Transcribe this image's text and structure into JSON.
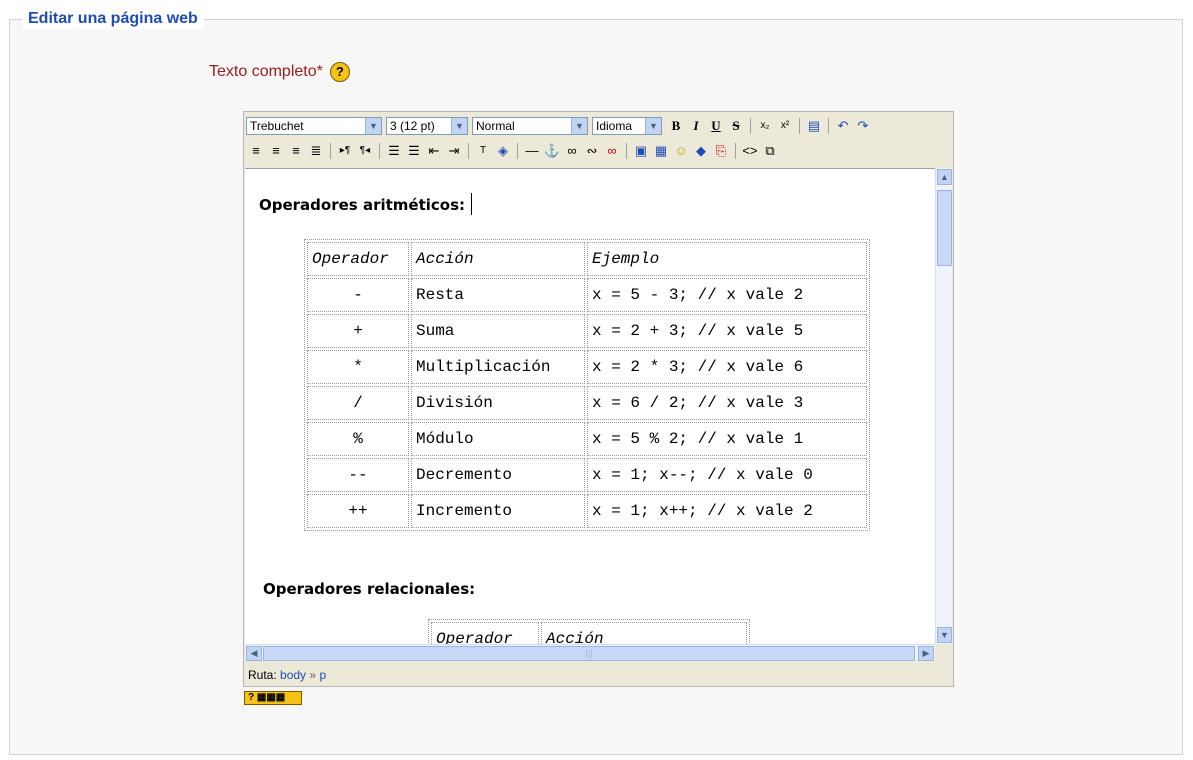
{
  "legend": "Editar una página web",
  "field": {
    "label": "Texto completo",
    "required_mark": "*",
    "help": "?"
  },
  "toolbar": {
    "font": "Trebuchet",
    "size": "3 (12 pt)",
    "format": "Normal",
    "language": "Idioma",
    "bold": "B",
    "italic": "I",
    "underline": "U",
    "strike": "S"
  },
  "content": {
    "heading1": "Operadores aritméticos:",
    "table": {
      "headers": [
        "Operador",
        "Acción",
        "Ejemplo"
      ],
      "rows": [
        [
          "-",
          "Resta",
          "x = 5 - 3; // x vale 2"
        ],
        [
          "+",
          "Suma",
          "x = 2 + 3; // x vale 5"
        ],
        [
          "*",
          "Multiplicación",
          "x = 2 * 3; // x vale 6"
        ],
        [
          "/",
          "División",
          "x = 6 / 2; // x vale 3"
        ],
        [
          "%",
          "Módulo",
          "x = 5 % 2; // x vale 1"
        ],
        [
          "--",
          "Decremento",
          "x = 1; x--; // x vale 0"
        ],
        [
          "++",
          "Incremento",
          "x = 1; x++; // x vale 2"
        ]
      ]
    },
    "heading2": "Operadores relacionales:",
    "table2_headers": [
      "Operador",
      "Acción"
    ]
  },
  "status": {
    "label": "Ruta:",
    "path1": "body",
    "sep": "»",
    "path2": "p"
  },
  "colors": {
    "legend": "#1f4bb4",
    "label": "#9b1c1c",
    "toolbar_bg": "#ece9d8"
  }
}
